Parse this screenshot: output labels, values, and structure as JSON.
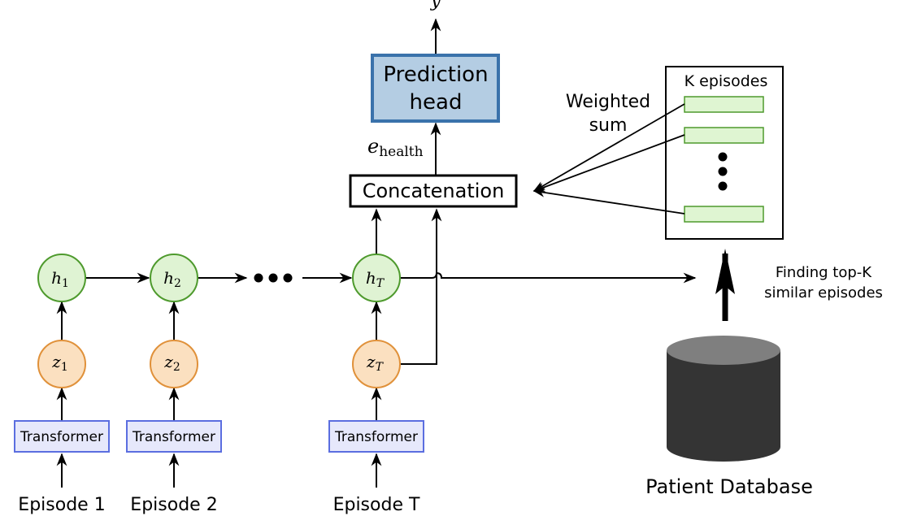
{
  "diagram": {
    "output_label": "y",
    "prediction_head": {
      "line1": "Prediction",
      "line2": "head"
    },
    "embedding_label": {
      "base": "e",
      "subscript": "health"
    },
    "concatenation": "Concatenation",
    "weighted_sum": {
      "line1": "Weighted",
      "line2": "sum"
    },
    "k_episodes": "K episodes",
    "finding": {
      "line1": "Finding top-K",
      "line2": "similar episodes"
    },
    "database": "Patient Database",
    "columns": [
      {
        "h_base": "h",
        "h_sub": "1",
        "z_base": "z",
        "z_sub": "1",
        "encoder": "Transformer",
        "episode": "Episode 1"
      },
      {
        "h_base": "h",
        "h_sub": "2",
        "z_base": "z",
        "z_sub": "2",
        "encoder": "Transformer",
        "episode": "Episode 2"
      },
      {
        "h_base": "h",
        "h_sub": "T",
        "z_base": "z",
        "z_sub": "T",
        "encoder": "Transformer",
        "episode": "Episode T"
      }
    ],
    "colors": {
      "h_fill": "#dff3d3",
      "h_stroke": "#4e9a2d",
      "z_fill": "#fbe0c0",
      "z_stroke": "#e0913a",
      "encoder_fill": "#e6e8fb",
      "encoder_stroke": "#5b6ee0",
      "head_fill": "#b4cde3",
      "head_stroke": "#3a72ab",
      "episode_fill": "#dff5d2",
      "episode_stroke": "#4e9a2d",
      "db_body": "#343434",
      "db_top": "#7f7f7f"
    }
  }
}
